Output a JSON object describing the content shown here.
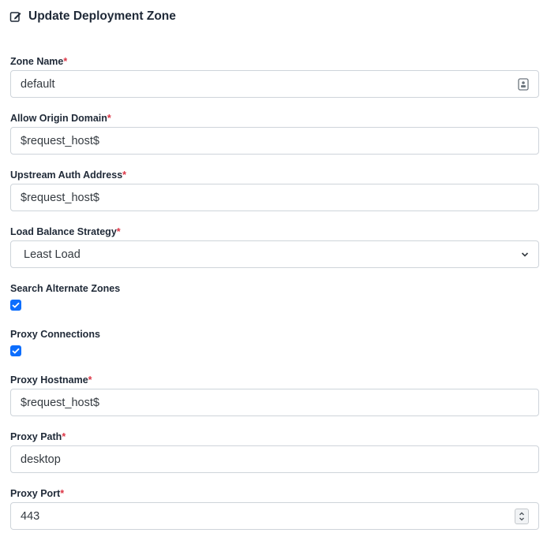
{
  "header": {
    "title": "Update Deployment Zone",
    "icon": "edit-icon"
  },
  "fields": {
    "zone_name": {
      "label": "Zone Name",
      "required": "*",
      "value": "default",
      "icon": "contact-card-icon"
    },
    "allow_origin_domain": {
      "label": "Allow Origin Domain",
      "required": "*",
      "value": "$request_host$"
    },
    "upstream_auth_address": {
      "label": "Upstream Auth Address",
      "required": "*",
      "value": "$request_host$"
    },
    "load_balance_strategy": {
      "label": "Load Balance Strategy",
      "required": "*",
      "value": "Least Load",
      "icon": "chevron-down-icon"
    },
    "search_alternate_zones": {
      "label": "Search Alternate Zones",
      "checked": true
    },
    "proxy_connections": {
      "label": "Proxy Connections",
      "checked": true
    },
    "proxy_hostname": {
      "label": "Proxy Hostname",
      "required": "*",
      "value": "$request_host$"
    },
    "proxy_path": {
      "label": "Proxy Path",
      "required": "*",
      "value": "desktop"
    },
    "proxy_port": {
      "label": "Proxy Port",
      "required": "*",
      "value": "443",
      "icon": "number-spinner-icon"
    }
  },
  "colors": {
    "required": "#dc3545",
    "checkbox": "#0d6efd",
    "border": "#ced4da"
  }
}
